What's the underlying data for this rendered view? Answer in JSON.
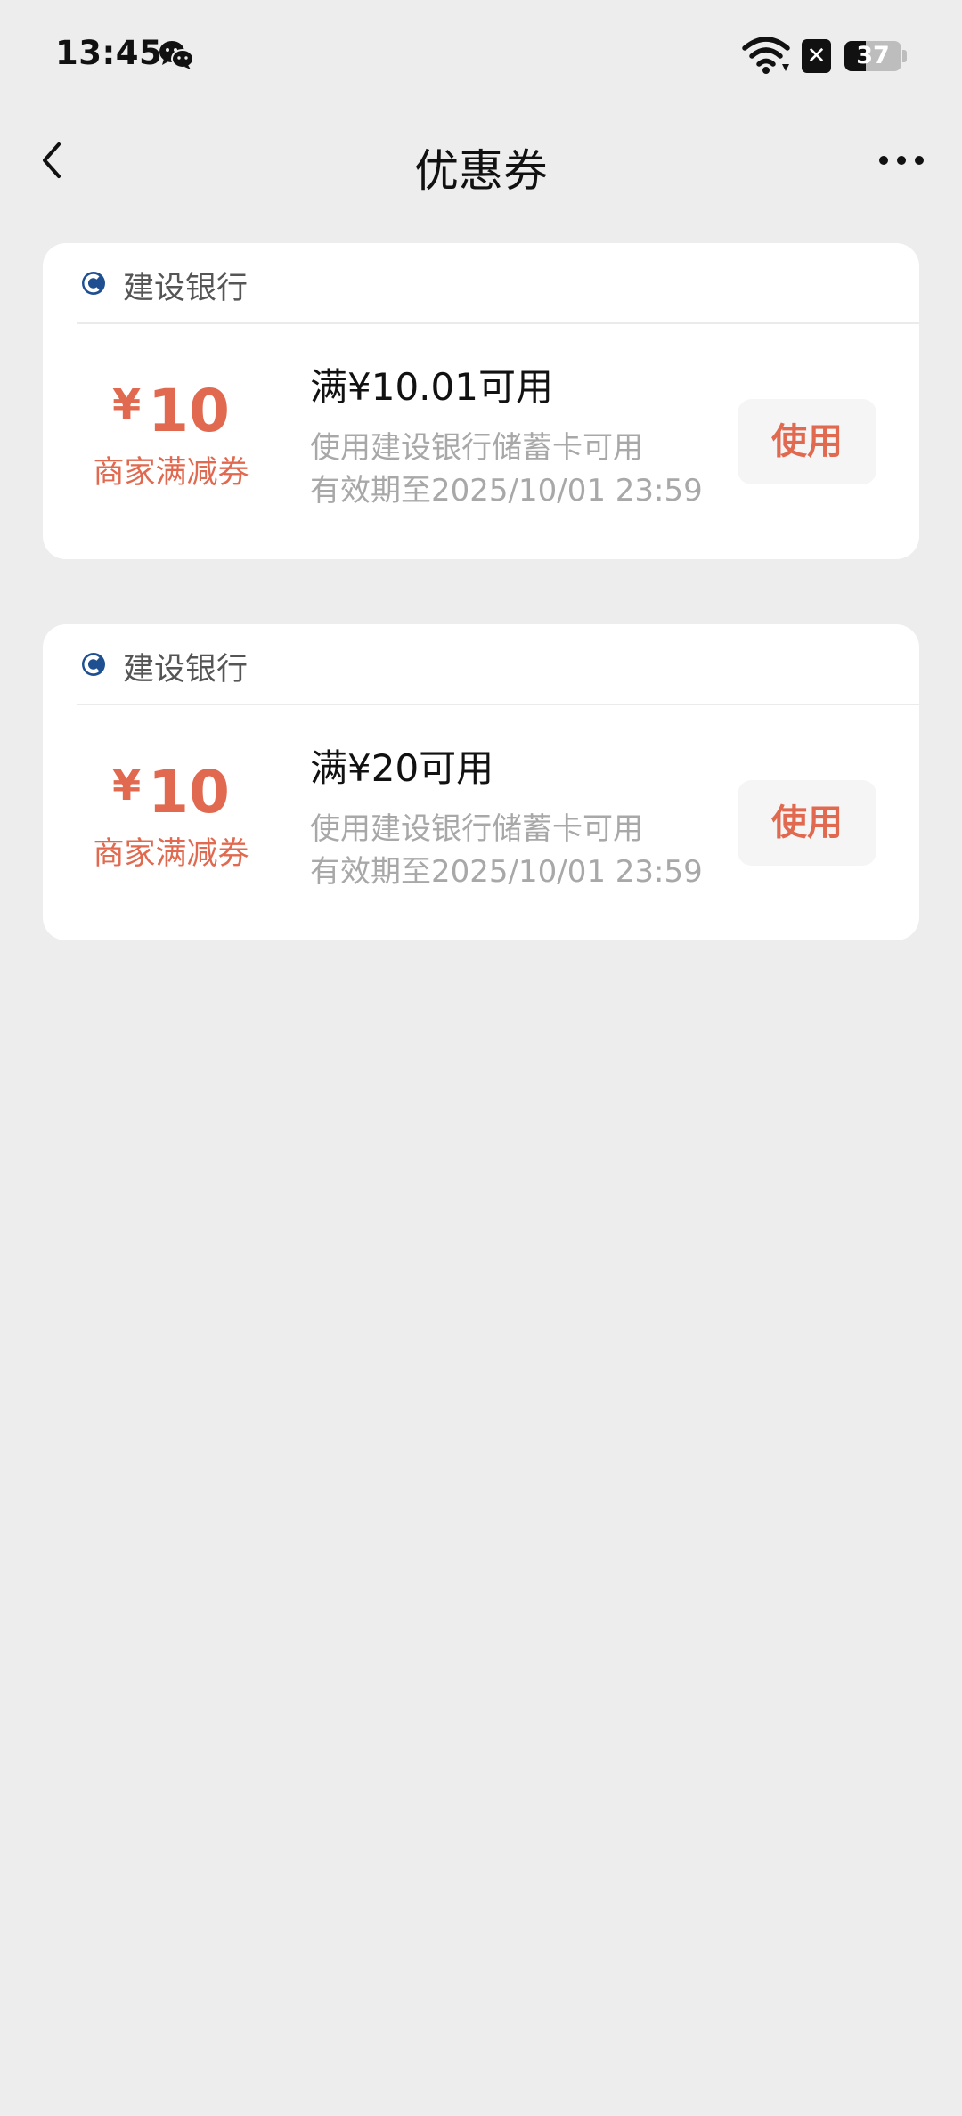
{
  "status_bar": {
    "time": "13:45",
    "battery_level": 37,
    "battery_text": "37",
    "sim_badge": "✕",
    "icons": [
      "wechat-icon",
      "wifi-icon",
      "sim-x-icon",
      "battery-icon"
    ]
  },
  "nav": {
    "title": "优惠券",
    "back_icon": "chevron-left-icon",
    "more_icon": "more-dots-icon"
  },
  "colors": {
    "background": "#ededed",
    "card": "#ffffff",
    "accent": "#e0694f",
    "bank_brand": "#1d4f91",
    "muted_text": "#a8a8a8"
  },
  "coupons": [
    {
      "bank_name": "建设银行",
      "bank_icon": "ccb-logo-icon",
      "currency": "¥",
      "amount": "10",
      "type": "商家满减券",
      "condition": "满¥10.01可用",
      "description": "使用建设银行储蓄卡可用",
      "expiry": "有效期至2025/10/01 23:59",
      "action_label": "使用"
    },
    {
      "bank_name": "建设银行",
      "bank_icon": "ccb-logo-icon",
      "currency": "¥",
      "amount": "10",
      "type": "商家满减券",
      "condition": "满¥20可用",
      "description": "使用建设银行储蓄卡可用",
      "expiry": "有效期至2025/10/01 23:59",
      "action_label": "使用"
    }
  ]
}
